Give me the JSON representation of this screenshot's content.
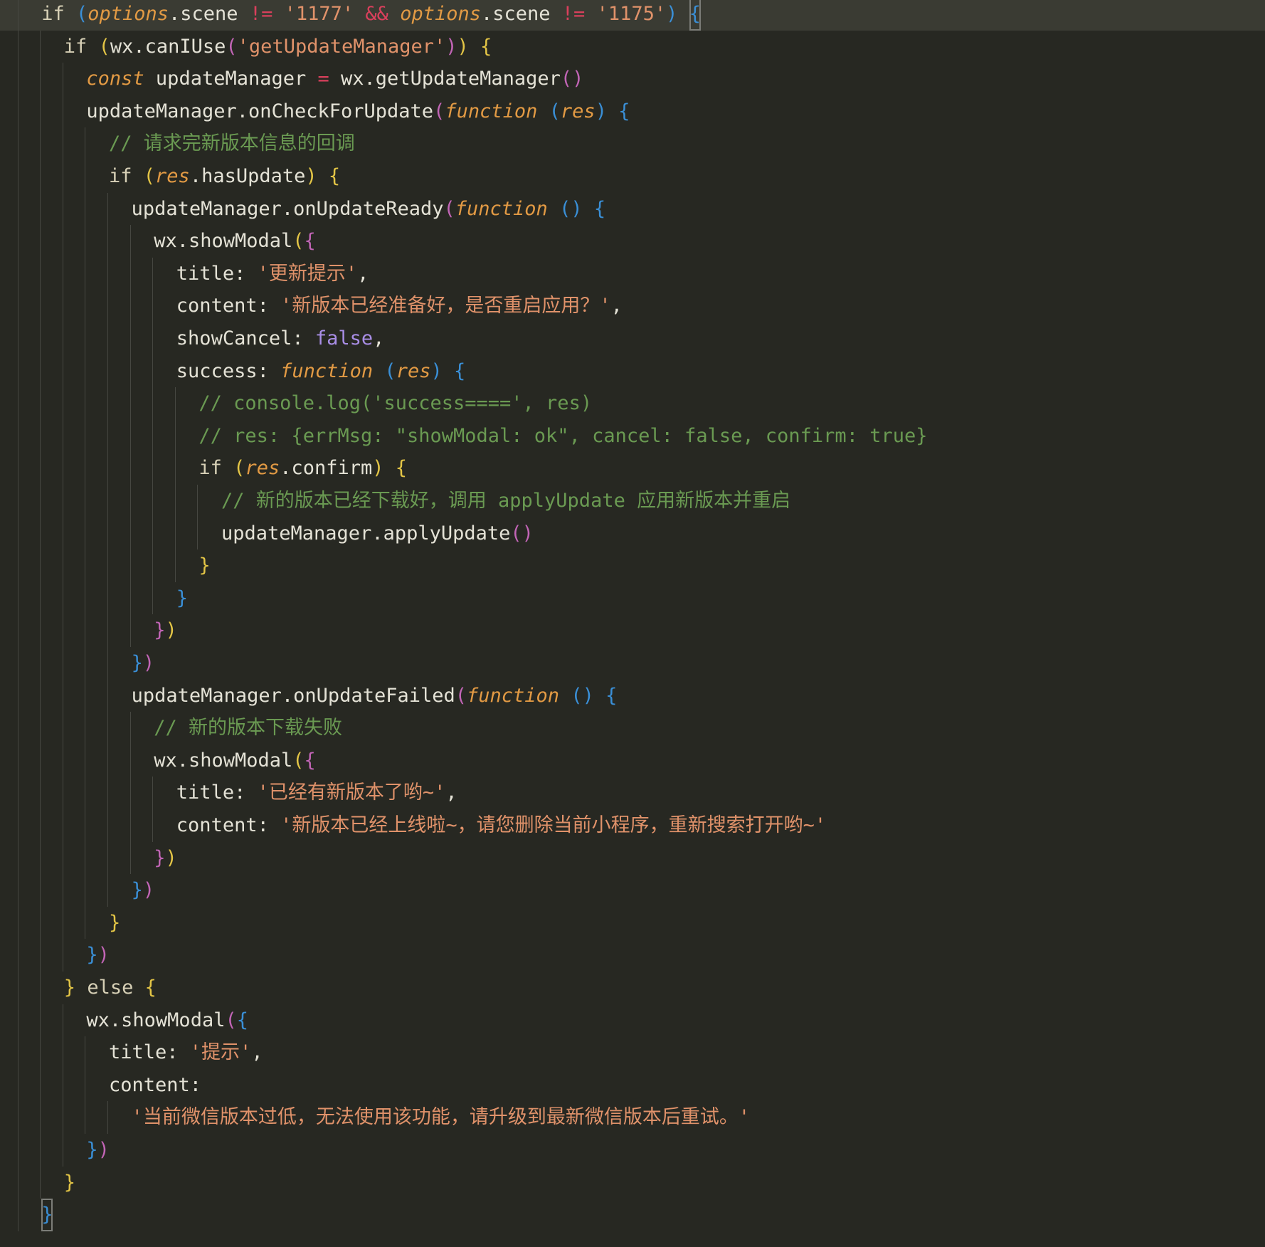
{
  "editor": {
    "theme_colors": {
      "background": "#272822",
      "current_line": "#3a3b33",
      "string": "#e0926a",
      "comment": "#6a9a52",
      "operator": "#d9405c",
      "parameter": "#e29a44",
      "boolean": "#a98ee6",
      "bracket_level_1": "#e3c546",
      "bracket_level_2": "#c265b6",
      "bracket_level_3": "#3a8fd6"
    },
    "lines": [
      {
        "indent": 2,
        "current": true,
        "tokens": [
          {
            "t": "if",
            "c": "kw"
          },
          {
            "t": " ",
            "c": "plain"
          },
          {
            "t": "(",
            "c": "b3"
          },
          {
            "t": "options",
            "c": "param"
          },
          {
            "t": ".scene ",
            "c": "plain"
          },
          {
            "t": "!=",
            "c": "op"
          },
          {
            "t": " ",
            "c": "plain"
          },
          {
            "t": "'1177'",
            "c": "str"
          },
          {
            "t": " ",
            "c": "plain"
          },
          {
            "t": "&&",
            "c": "op"
          },
          {
            "t": " ",
            "c": "plain"
          },
          {
            "t": "options",
            "c": "param"
          },
          {
            "t": ".scene ",
            "c": "plain"
          },
          {
            "t": "!=",
            "c": "op"
          },
          {
            "t": " ",
            "c": "plain"
          },
          {
            "t": "'1175'",
            "c": "str"
          },
          {
            "t": ")",
            "c": "b3"
          },
          {
            "t": " ",
            "c": "plain"
          },
          {
            "t": "{",
            "c": "b3",
            "caret": true
          }
        ]
      },
      {
        "indent": 3,
        "tokens": [
          {
            "t": "if",
            "c": "kw"
          },
          {
            "t": " ",
            "c": "plain"
          },
          {
            "t": "(",
            "c": "b1"
          },
          {
            "t": "wx.canIUse",
            "c": "plain"
          },
          {
            "t": "(",
            "c": "b2"
          },
          {
            "t": "'getUpdateManager'",
            "c": "str"
          },
          {
            "t": ")",
            "c": "b2"
          },
          {
            "t": ")",
            "c": "b1"
          },
          {
            "t": " ",
            "c": "plain"
          },
          {
            "t": "{",
            "c": "b1"
          }
        ]
      },
      {
        "indent": 4,
        "tokens": [
          {
            "t": "const",
            "c": "italic-kw"
          },
          {
            "t": " updateManager ",
            "c": "plain"
          },
          {
            "t": "=",
            "c": "op"
          },
          {
            "t": " wx.getUpdateManager",
            "c": "plain"
          },
          {
            "t": "()",
            "c": "b2"
          }
        ]
      },
      {
        "indent": 4,
        "tokens": [
          {
            "t": "updateManager.onCheckForUpdate",
            "c": "plain"
          },
          {
            "t": "(",
            "c": "b2"
          },
          {
            "t": "function",
            "c": "italic-kw"
          },
          {
            "t": " ",
            "c": "plain"
          },
          {
            "t": "(",
            "c": "b3"
          },
          {
            "t": "res",
            "c": "param"
          },
          {
            "t": ")",
            "c": "b3"
          },
          {
            "t": " ",
            "c": "plain"
          },
          {
            "t": "{",
            "c": "b3"
          }
        ]
      },
      {
        "indent": 5,
        "tokens": [
          {
            "t": "// 请求完新版本信息的回调",
            "c": "comment"
          }
        ]
      },
      {
        "indent": 5,
        "tokens": [
          {
            "t": "if",
            "c": "kw"
          },
          {
            "t": " ",
            "c": "plain"
          },
          {
            "t": "(",
            "c": "b1"
          },
          {
            "t": "res",
            "c": "param"
          },
          {
            "t": ".hasUpdate",
            "c": "plain"
          },
          {
            "t": ")",
            "c": "b1"
          },
          {
            "t": " ",
            "c": "plain"
          },
          {
            "t": "{",
            "c": "b1"
          }
        ]
      },
      {
        "indent": 6,
        "tokens": [
          {
            "t": "updateManager.onUpdateReady",
            "c": "plain"
          },
          {
            "t": "(",
            "c": "b2"
          },
          {
            "t": "function",
            "c": "italic-kw"
          },
          {
            "t": " ",
            "c": "plain"
          },
          {
            "t": "()",
            "c": "b3"
          },
          {
            "t": " ",
            "c": "plain"
          },
          {
            "t": "{",
            "c": "b3"
          }
        ]
      },
      {
        "indent": 7,
        "tokens": [
          {
            "t": "wx.showModal",
            "c": "plain"
          },
          {
            "t": "(",
            "c": "b1"
          },
          {
            "t": "{",
            "c": "b2"
          }
        ]
      },
      {
        "indent": 8,
        "tokens": [
          {
            "t": "title",
            "c": "plain"
          },
          {
            "t": ": ",
            "c": "plain"
          },
          {
            "t": "'更新提示'",
            "c": "str"
          },
          {
            "t": ",",
            "c": "plain"
          }
        ]
      },
      {
        "indent": 8,
        "tokens": [
          {
            "t": "content",
            "c": "plain"
          },
          {
            "t": ": ",
            "c": "plain"
          },
          {
            "t": "'新版本已经准备好，是否重启应用？'",
            "c": "str"
          },
          {
            "t": ",",
            "c": "plain"
          }
        ]
      },
      {
        "indent": 8,
        "tokens": [
          {
            "t": "showCancel",
            "c": "plain"
          },
          {
            "t": ": ",
            "c": "plain"
          },
          {
            "t": "false",
            "c": "bool"
          },
          {
            "t": ",",
            "c": "plain"
          }
        ]
      },
      {
        "indent": 8,
        "tokens": [
          {
            "t": "success",
            "c": "plain"
          },
          {
            "t": ": ",
            "c": "plain"
          },
          {
            "t": "function",
            "c": "italic-kw"
          },
          {
            "t": " ",
            "c": "plain"
          },
          {
            "t": "(",
            "c": "b3"
          },
          {
            "t": "res",
            "c": "param"
          },
          {
            "t": ")",
            "c": "b3"
          },
          {
            "t": " ",
            "c": "plain"
          },
          {
            "t": "{",
            "c": "b3"
          }
        ]
      },
      {
        "indent": 9,
        "tokens": [
          {
            "t": "// console.log('success====', res)",
            "c": "comment"
          }
        ]
      },
      {
        "indent": 9,
        "tokens": [
          {
            "t": "// res: {errMsg: \"showModal: ok\", cancel: false, confirm: true}",
            "c": "comment"
          }
        ]
      },
      {
        "indent": 9,
        "tokens": [
          {
            "t": "if",
            "c": "kw"
          },
          {
            "t": " ",
            "c": "plain"
          },
          {
            "t": "(",
            "c": "b1"
          },
          {
            "t": "res",
            "c": "param"
          },
          {
            "t": ".confirm",
            "c": "plain"
          },
          {
            "t": ")",
            "c": "b1"
          },
          {
            "t": " ",
            "c": "plain"
          },
          {
            "t": "{",
            "c": "b1"
          }
        ]
      },
      {
        "indent": 10,
        "tokens": [
          {
            "t": "// 新的版本已经下载好，调用 applyUpdate 应用新版本并重启",
            "c": "comment"
          }
        ]
      },
      {
        "indent": 10,
        "tokens": [
          {
            "t": "updateManager.applyUpdate",
            "c": "plain"
          },
          {
            "t": "()",
            "c": "b2"
          }
        ]
      },
      {
        "indent": 9,
        "tokens": [
          {
            "t": "}",
            "c": "b1"
          }
        ]
      },
      {
        "indent": 8,
        "tokens": [
          {
            "t": "}",
            "c": "b3"
          }
        ]
      },
      {
        "indent": 7,
        "tokens": [
          {
            "t": "}",
            "c": "b2"
          },
          {
            "t": ")",
            "c": "b1"
          }
        ]
      },
      {
        "indent": 6,
        "tokens": [
          {
            "t": "}",
            "c": "b3"
          },
          {
            "t": ")",
            "c": "b2"
          }
        ]
      },
      {
        "indent": 6,
        "tokens": [
          {
            "t": "updateManager.onUpdateFailed",
            "c": "plain"
          },
          {
            "t": "(",
            "c": "b2"
          },
          {
            "t": "function",
            "c": "italic-kw"
          },
          {
            "t": " ",
            "c": "plain"
          },
          {
            "t": "()",
            "c": "b3"
          },
          {
            "t": " ",
            "c": "plain"
          },
          {
            "t": "{",
            "c": "b3"
          }
        ]
      },
      {
        "indent": 7,
        "tokens": [
          {
            "t": "// 新的版本下载失败",
            "c": "comment"
          }
        ]
      },
      {
        "indent": 7,
        "tokens": [
          {
            "t": "wx.showModal",
            "c": "plain"
          },
          {
            "t": "(",
            "c": "b1"
          },
          {
            "t": "{",
            "c": "b2"
          }
        ]
      },
      {
        "indent": 8,
        "tokens": [
          {
            "t": "title",
            "c": "plain"
          },
          {
            "t": ": ",
            "c": "plain"
          },
          {
            "t": "'已经有新版本了哟~'",
            "c": "str"
          },
          {
            "t": ",",
            "c": "plain"
          }
        ]
      },
      {
        "indent": 8,
        "tokens": [
          {
            "t": "content",
            "c": "plain"
          },
          {
            "t": ": ",
            "c": "plain"
          },
          {
            "t": "'新版本已经上线啦~，请您删除当前小程序，重新搜索打开哟~'",
            "c": "str"
          }
        ]
      },
      {
        "indent": 7,
        "tokens": [
          {
            "t": "}",
            "c": "b2"
          },
          {
            "t": ")",
            "c": "b1"
          }
        ]
      },
      {
        "indent": 6,
        "tokens": [
          {
            "t": "}",
            "c": "b3"
          },
          {
            "t": ")",
            "c": "b2"
          }
        ]
      },
      {
        "indent": 5,
        "tokens": [
          {
            "t": "}",
            "c": "b1"
          }
        ]
      },
      {
        "indent": 4,
        "tokens": [
          {
            "t": "}",
            "c": "b3"
          },
          {
            "t": ")",
            "c": "b2"
          }
        ]
      },
      {
        "indent": 3,
        "tokens": [
          {
            "t": "}",
            "c": "b1"
          },
          {
            "t": " ",
            "c": "plain"
          },
          {
            "t": "else",
            "c": "kw"
          },
          {
            "t": " ",
            "c": "plain"
          },
          {
            "t": "{",
            "c": "b1"
          }
        ]
      },
      {
        "indent": 4,
        "tokens": [
          {
            "t": "wx.showModal",
            "c": "plain"
          },
          {
            "t": "(",
            "c": "b2"
          },
          {
            "t": "{",
            "c": "b3"
          }
        ]
      },
      {
        "indent": 5,
        "tokens": [
          {
            "t": "title",
            "c": "plain"
          },
          {
            "t": ": ",
            "c": "plain"
          },
          {
            "t": "'提示'",
            "c": "str"
          },
          {
            "t": ",",
            "c": "plain"
          }
        ]
      },
      {
        "indent": 5,
        "tokens": [
          {
            "t": "content",
            "c": "plain"
          },
          {
            "t": ":",
            "c": "plain"
          }
        ]
      },
      {
        "indent": 6,
        "tokens": [
          {
            "t": "'当前微信版本过低，无法使用该功能，请升级到最新微信版本后重试。'",
            "c": "str"
          }
        ]
      },
      {
        "indent": 4,
        "tokens": [
          {
            "t": "}",
            "c": "b3"
          },
          {
            "t": ")",
            "c": "b2"
          }
        ]
      },
      {
        "indent": 3,
        "tokens": [
          {
            "t": "}",
            "c": "b1"
          }
        ]
      },
      {
        "indent": 2,
        "tokens": [
          {
            "t": "}",
            "c": "b3",
            "caret": true
          }
        ]
      }
    ]
  }
}
